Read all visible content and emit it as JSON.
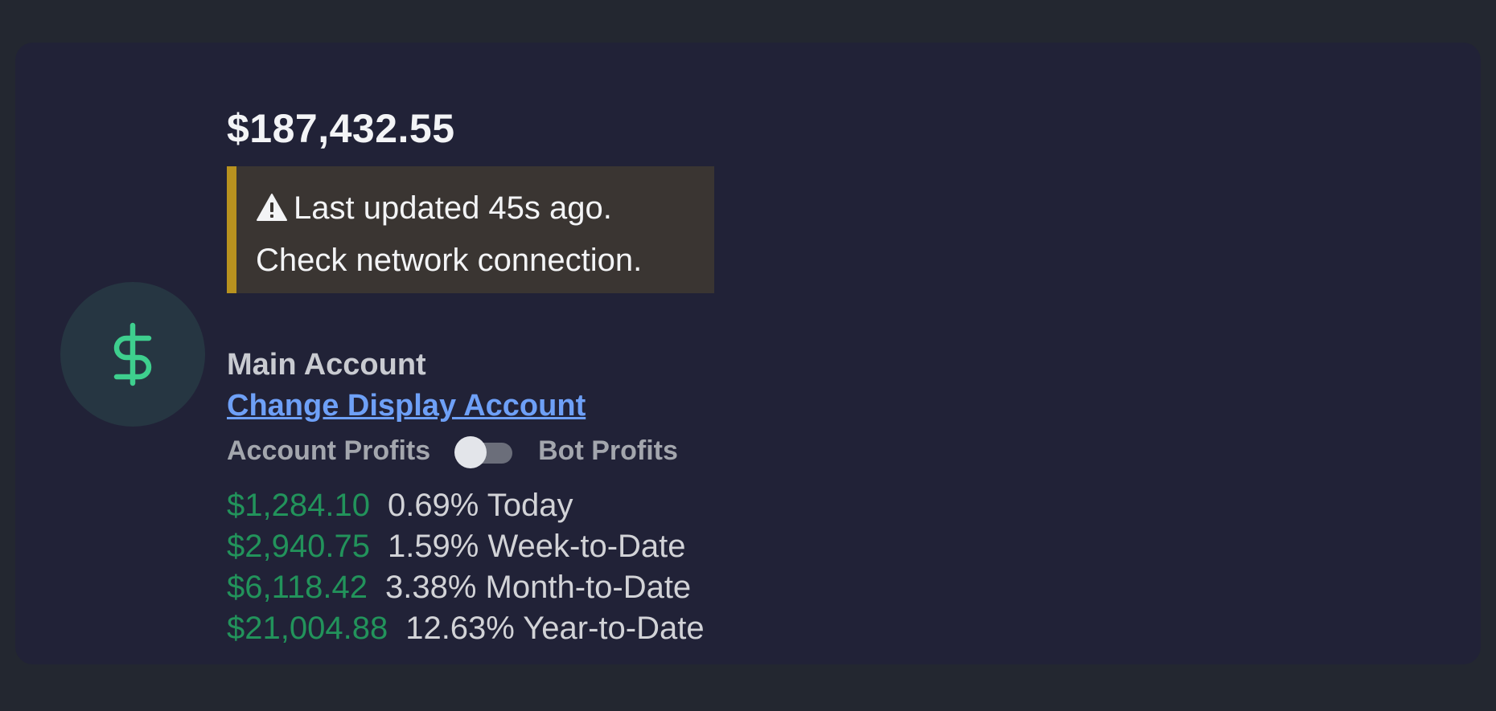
{
  "account_card": {
    "balance": "$187,432.55",
    "avatar_icon": "dollar-icon",
    "warning": {
      "icon": "warning-triangle-icon",
      "line1": "Last updated 45s ago.",
      "line2": "Check network connection."
    },
    "account_name": "Main Account",
    "change_account_link": "Change Display Account",
    "toggle": {
      "left_label": "Account Profits",
      "right_label": "Bot Profits",
      "checked": false
    },
    "profits": [
      {
        "amount": "$1,284.10",
        "percent_label": "0.69% Today"
      },
      {
        "amount": "$2,940.75",
        "percent_label": "1.59% Week-to-Date"
      },
      {
        "amount": "$6,118.42",
        "percent_label": "3.38% Month-to-Date"
      },
      {
        "amount": "$21,004.88",
        "percent_label": "12.63% Year-to-Date"
      }
    ]
  },
  "colors": {
    "page_background": "#232730",
    "card_background": "#212237",
    "avatar_background": "#263642",
    "dollar_icon": "#3ecf8e",
    "warning_background": "#3a3532",
    "warning_border": "#b8921f",
    "link": "#6ea0f7",
    "profit_positive": "#22935b"
  }
}
